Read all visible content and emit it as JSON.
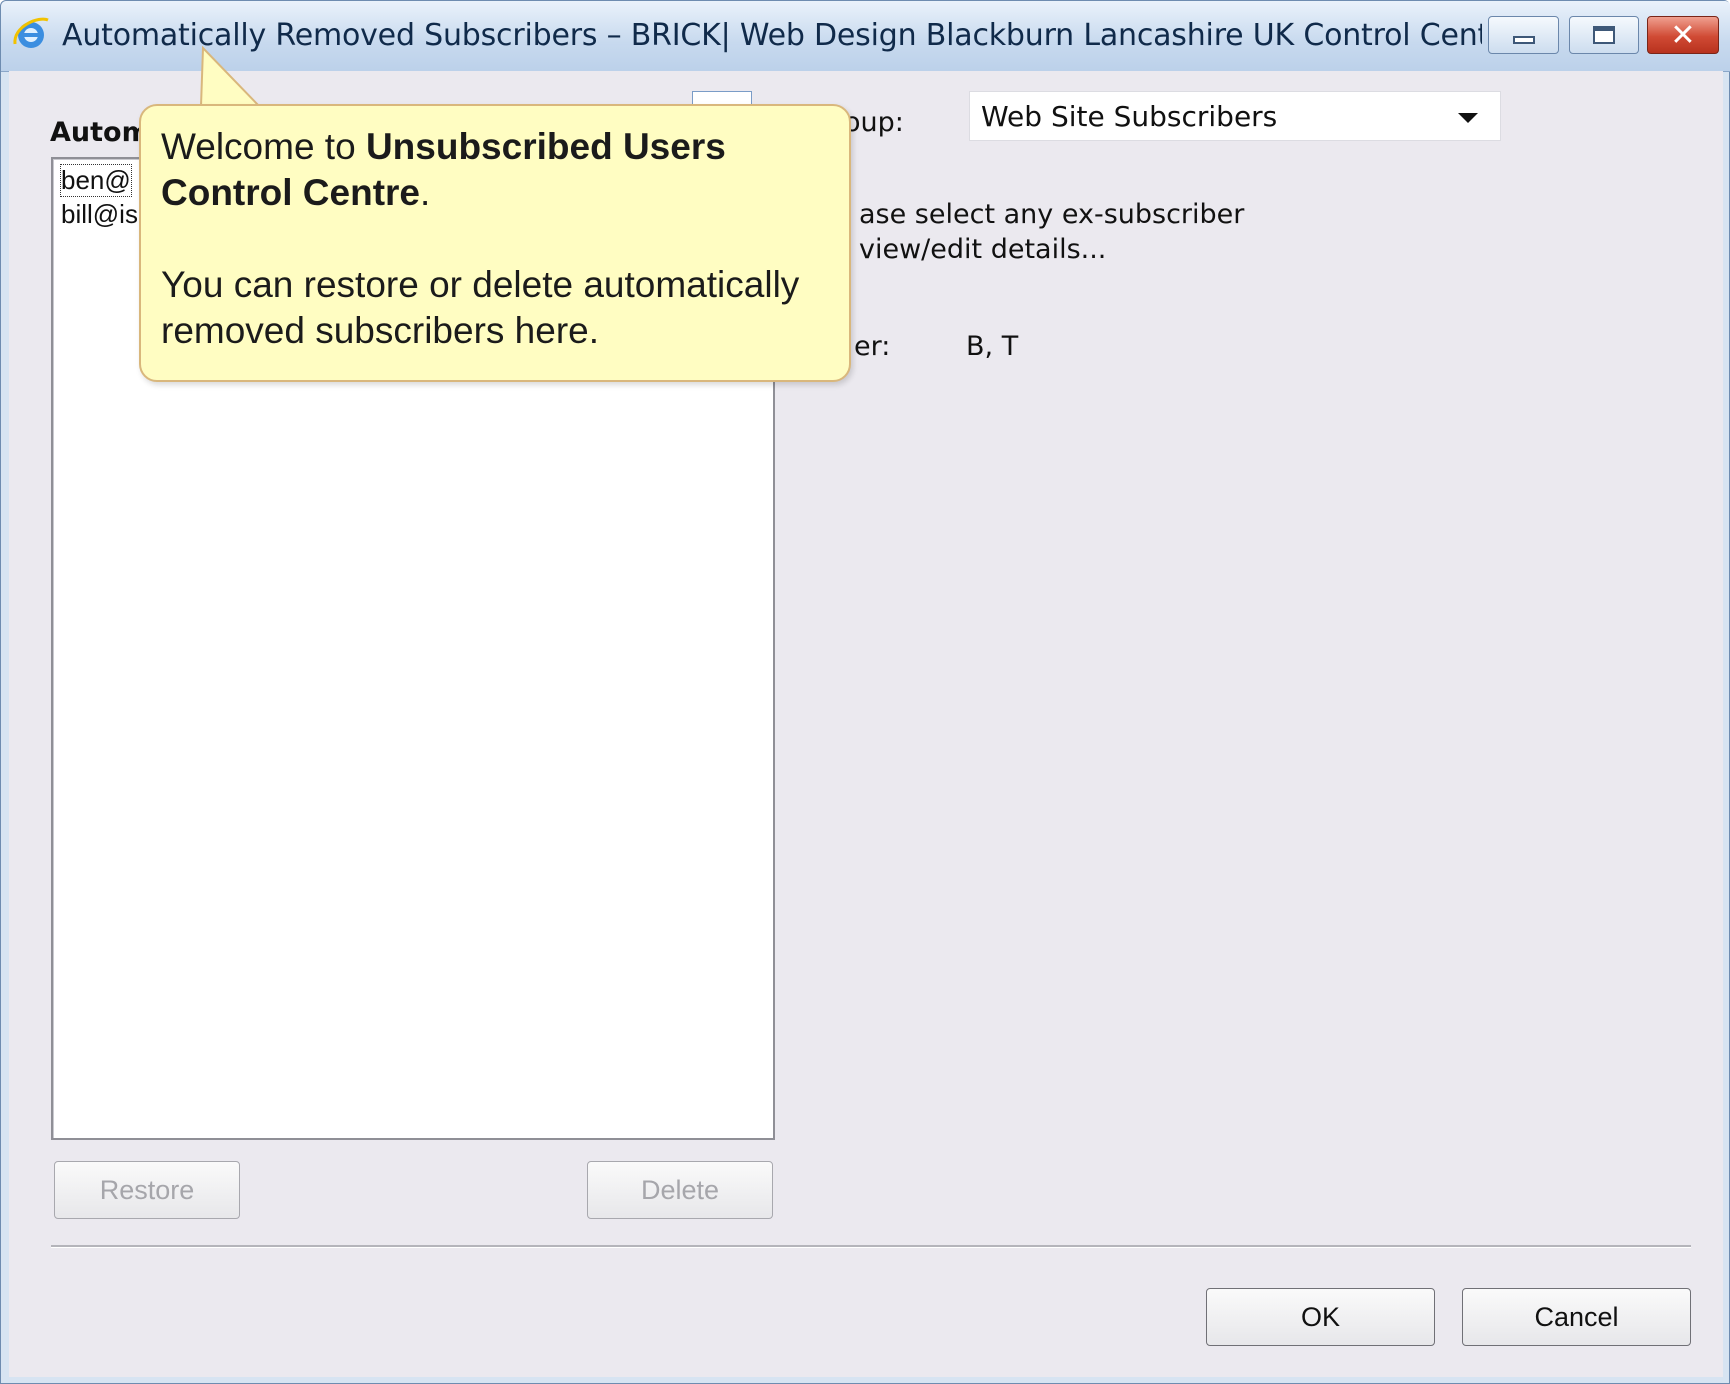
{
  "window": {
    "title": "Automatically Removed Subscribers – BRICK| Web Design Blackburn Lancashire UK Control Centre ...",
    "icon": "internet-explorer-icon",
    "controls": {
      "minimize": "minimize-icon",
      "maximize": "maximize-icon",
      "close": "✕"
    }
  },
  "left_panel": {
    "label": "Autom",
    "items": [
      "ben@",
      "bill@is"
    ],
    "restore_label": "Restore",
    "delete_label": "Delete"
  },
  "right_panel": {
    "group_label": "oup:",
    "group_value": "Web Site Subscribers",
    "info_line1": "ase select any ex-subscriber",
    "info_line2": "view/edit details...",
    "field_label": "er:",
    "field_value": "B, T"
  },
  "footer": {
    "ok_label": "OK",
    "cancel_label": "Cancel"
  },
  "callout": {
    "welcome_prefix": "Welcome to ",
    "welcome_bold": "Unsubscribed Users Control Centre",
    "welcome_suffix": ".",
    "body": "You can restore or delete automatically removed subscribers here."
  },
  "colors": {
    "titlebar": "#c7d9ee",
    "dialog_bg": "#ebe9ef",
    "callout_bg": "#fffdc2",
    "callout_border": "#d9b77c",
    "close_button": "#d04a34"
  }
}
